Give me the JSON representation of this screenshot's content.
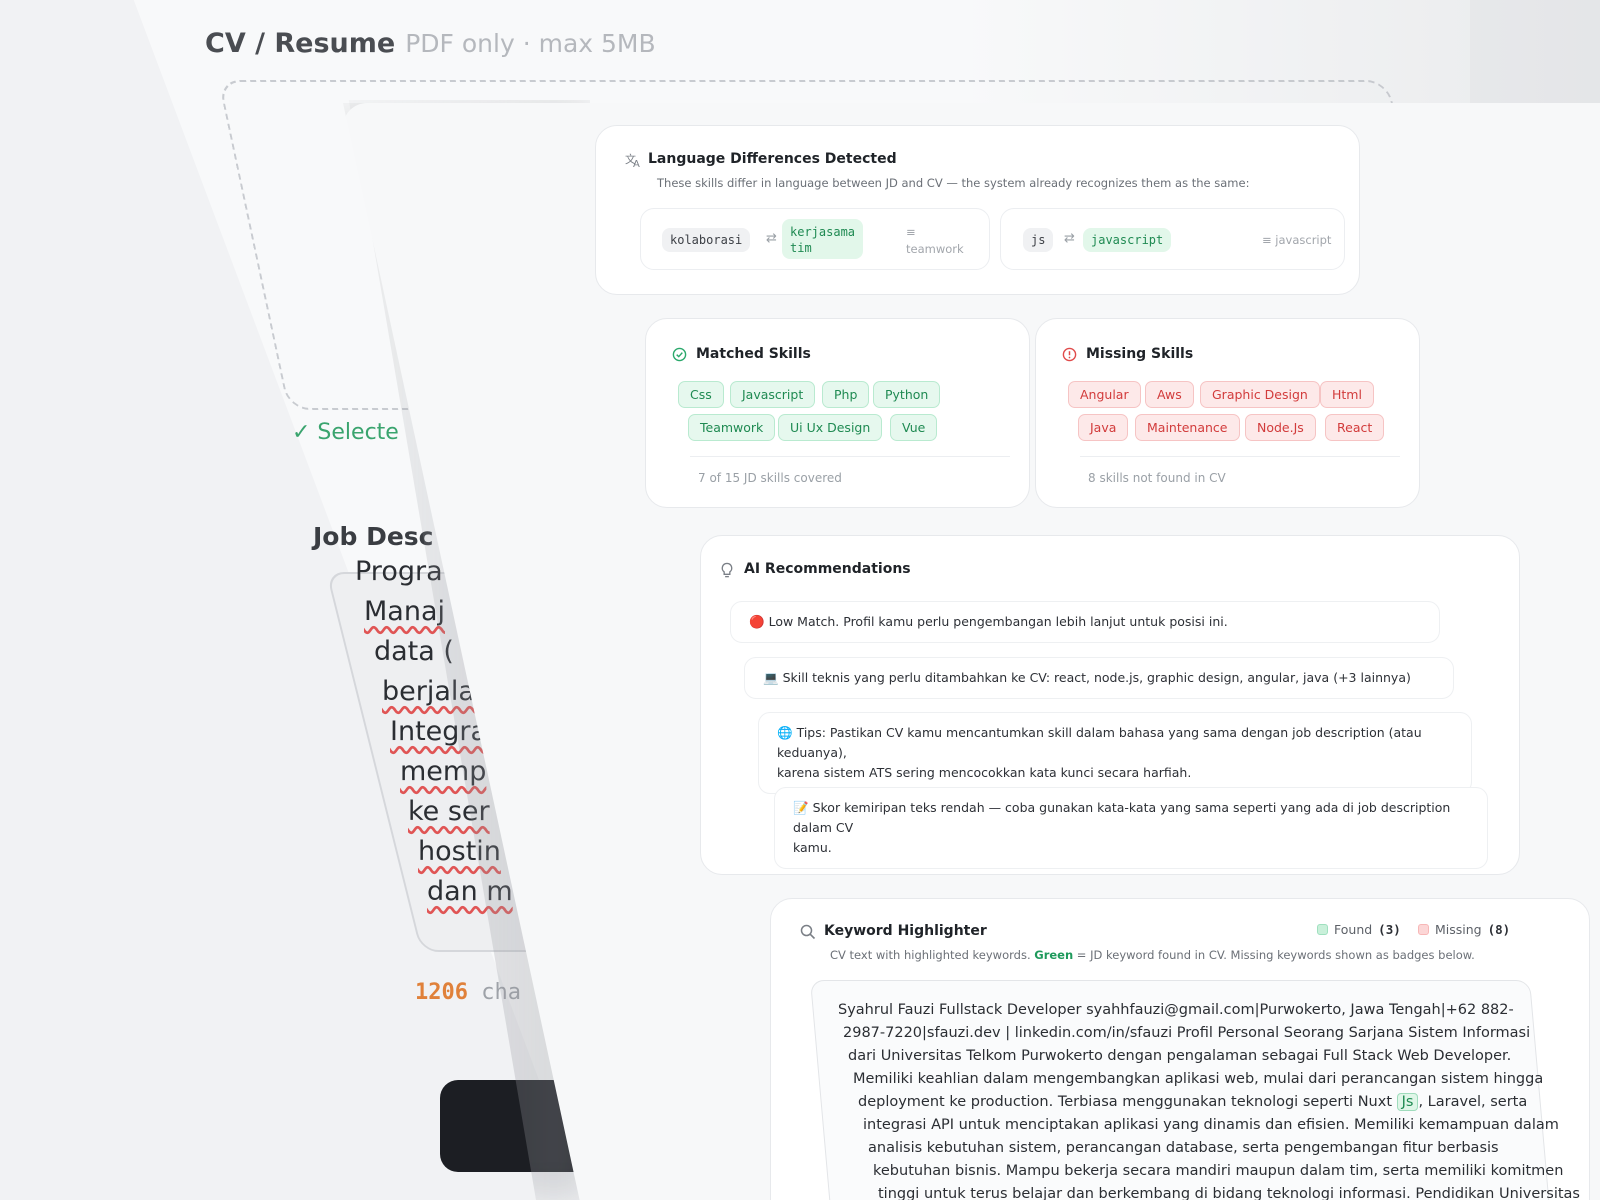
{
  "upload_form": {
    "cv_title": "CV / Resume",
    "cv_hint": "PDF only · max 5MB",
    "selected_text": "✓ Selecte",
    "jd_label": "Job Desc",
    "jd_lines": [
      "Progra",
      "Manaj",
      "data (",
      "berjala",
      "Integra",
      "memp",
      "ke ser",
      "hostin",
      "dan m"
    ],
    "char_count": "1206",
    "char_unit": "cha"
  },
  "language_diff": {
    "title": "Language Differences Detected",
    "subtitle": "These skills differ in language between JD and CV — the system already recognizes them as the same:",
    "pairs": [
      {
        "jd": "kolaborasi",
        "cv_line1": "kerjasama",
        "cv_line2": "tim",
        "canonical": "≡ teamwork"
      },
      {
        "jd": "js",
        "cv_line1": "javascript",
        "cv_line2": "",
        "canonical": "≡ javascript"
      }
    ]
  },
  "matched_skills": {
    "title": "Matched Skills",
    "tags": [
      "Css",
      "Javascript",
      "Php",
      "Python",
      "Teamwork",
      "Ui Ux Design",
      "Vue"
    ],
    "footer": "7 of 15 JD skills covered"
  },
  "missing_skills": {
    "title": "Missing Skills",
    "tags": [
      "Angular",
      "Aws",
      "Graphic Design",
      "Html",
      "Java",
      "Maintenance",
      "Node.Js",
      "React"
    ],
    "footer": "8 skills not found in CV"
  },
  "recommendations": {
    "title": "AI Recommendations",
    "items": [
      {
        "emoji": "🔴",
        "line1": "Low Match. Profil kamu perlu pengembangan lebih lanjut untuk posisi ini.",
        "line2": ""
      },
      {
        "emoji": "💻",
        "line1": "Skill teknis yang perlu ditambahkan ke CV: react, node.js, graphic design, angular, java (+3 lainnya)",
        "line2": ""
      },
      {
        "emoji": "🌐",
        "line1": "Tips: Pastikan CV kamu mencantumkan skill dalam bahasa yang sama dengan job description (atau keduanya),",
        "line2": "karena sistem ATS sering mencocokkan kata kunci secara harfiah."
      },
      {
        "emoji": "📝",
        "line1": "Skor kemiripan teks rendah — coba gunakan kata-kata yang sama seperti yang ada di job description dalam CV",
        "line2": "kamu."
      }
    ]
  },
  "keyword_highlighter": {
    "title": "Keyword Highlighter",
    "subtitle_pre": "CV text with highlighted keywords. ",
    "subtitle_green": "Green",
    "subtitle_post": " = JD keyword found in CV. Missing keywords shown as badges below.",
    "legend_found": "Found",
    "legend_found_count": "(3)",
    "legend_missing": "Missing",
    "legend_missing_count": "(8)",
    "colors": {
      "found": "#9fe0bf",
      "missing": "#f7b7b7"
    },
    "cv_lines": [
      "Syahrul Fauzi Fullstack Developer syahhfauzi@gmail.com|Purwokerto, Jawa Tengah|+62 882-",
      "2987-7220|sfauzi.dev | linkedin.com/in/sfauzi Profil Personal Seorang Sarjana Sistem Informasi",
      "dari Universitas Telkom Purwokerto dengan pengalaman sebagai Full Stack Web Developer.",
      "Memiliki keahlian dalam mengembangkan aplikasi web, mulai dari perancangan sistem hingga",
      "integrasi API untuk menciptakan aplikasi yang dinamis dan efisien. Memiliki kemampuan dalam",
      "analisis kebutuhan sistem, perancangan database, serta pengembangan fitur berbasis",
      "kebutuhan bisnis. Mampu bekerja secara mandiri maupun dalam tim, serta memiliki komitmen",
      "tinggi untuk terus belajar dan berkembang di bidang teknologi informasi. Pendidikan Universitas"
    ],
    "cv_line5_pre": "deployment ke production. Terbiasa menggunakan teknologi seperti Nuxt ",
    "cv_line5_kw": "Js",
    "cv_line5_post": ", Laravel, serta"
  },
  "icons": {
    "translate": "translate-icon",
    "check_circle": "check-circle-icon",
    "alert_circle": "alert-circle-icon",
    "lightbulb": "lightbulb-icon",
    "search": "search-icon",
    "swap": "swap-icon"
  }
}
